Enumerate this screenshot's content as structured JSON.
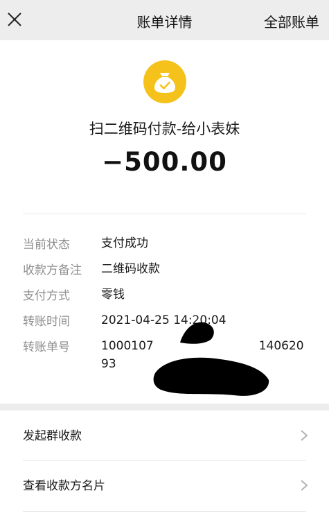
{
  "header": {
    "title": "账单详情",
    "all_bills": "全部账单"
  },
  "transaction": {
    "merchant": "扫二维码付款-给小表妹",
    "amount": "−500.00"
  },
  "details": [
    {
      "label": "当前状态",
      "value": "支付成功"
    },
    {
      "label": "收款方备注",
      "value": "二维码收款"
    },
    {
      "label": "支付方式",
      "value": "零钱"
    },
    {
      "label": "转账时间",
      "value": "2021-04-25 14:20:04"
    },
    {
      "label": "转账单号",
      "value": "1000107",
      "value_end": "140620",
      "value_line2": "93"
    }
  ],
  "actions": [
    {
      "label": "发起群收款"
    },
    {
      "label": "查看收款方名片"
    }
  ],
  "colors": {
    "accent": "#f4c21a",
    "background": "#ededed"
  }
}
